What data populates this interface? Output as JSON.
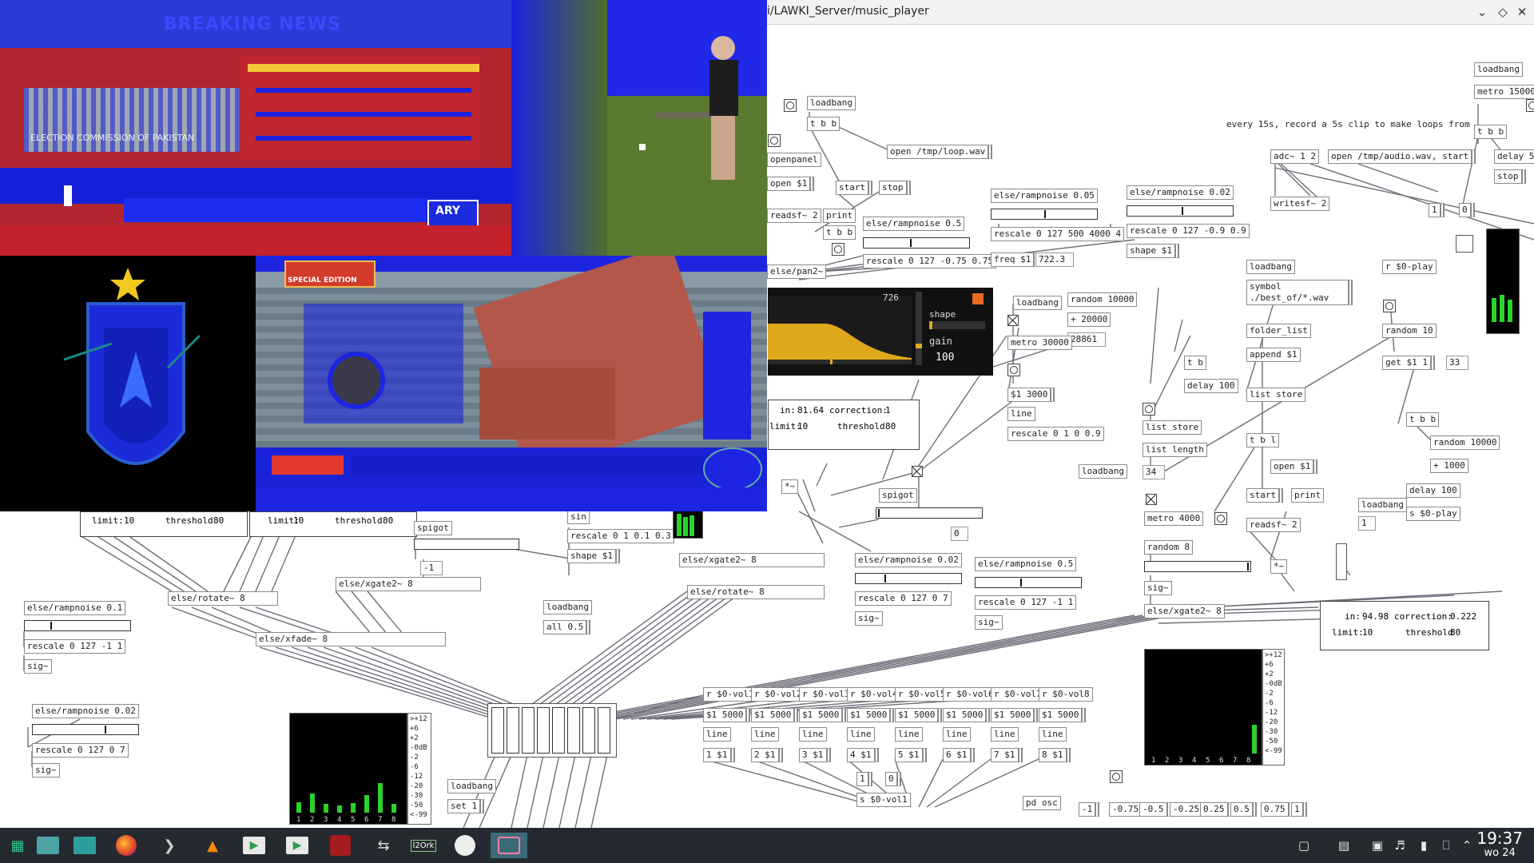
{
  "window": {
    "title": "i/LAWKI_Server/music_player",
    "controls": [
      "minimize",
      "maximize",
      "close"
    ]
  },
  "objects": {
    "loadbang1": "loadbang",
    "tbb1": "t b b",
    "openpanel": "openpanel",
    "open1": "open $1",
    "openloop": "open /tmp/loop.wav",
    "start1": "start",
    "stop1": "stop",
    "readsf1": "readsf~ 2",
    "print1": "print",
    "tbb2": "t b b",
    "rampnoise05": "else/rampnoise 0.5",
    "rescale075": "rescale 0 127 -0.75 0.75",
    "pan2": "else/pan2~",
    "rampnoise005": "else/rampnoise 0.05",
    "rescale500": "rescale 0 127 500 4000 4",
    "freq": "freq $1",
    "num7223": "722.3",
    "rampnoise002a": "else/rampnoise 0.02",
    "rescale09": "rescale 0 127 -0.9 0.9",
    "shape1": "shape $1",
    "loadbang2": "loadbang",
    "random10000a": "random 10000",
    "plus20000": "+ 20000",
    "num28861": "28861",
    "metro30000": "metro 30000",
    "msg3000": "$1 3000",
    "line1": "line",
    "rescale019": "rescale 0 1 0 0.9",
    "comment15s": "every 15s, record a 5s clip to make loops from",
    "loadbang3": "loadbang",
    "metro15000": "metro 15000",
    "tbb3": "t b b",
    "adc": "adc~ 1 2",
    "openaudio": "open /tmp/audio.wav, start",
    "delay5": "delay 5",
    "stop2": "stop",
    "writesf": "writesf~ 2",
    "num1": "1",
    "num0": "0",
    "loadbang4": "loadbang",
    "symbol": "symbol ./best_of/*.wav",
    "folderlist": "folder_list",
    "append": "append $1",
    "liststore1": "list store",
    "rplay": "r $0-play",
    "random10": "random 10",
    "get1": "get $1 1",
    "num33": "33",
    "tb": "t b",
    "delay100a": "delay 100",
    "liststore2": "list store",
    "listlength": "list length",
    "num34": "34",
    "tbl": "t b l",
    "open2": "open $1",
    "print2": "print",
    "start2": "start",
    "readsf2": "readsf~ 2",
    "tbb4": "t b b",
    "random10000b": "random 10000",
    "plus1000": "+ 1000",
    "delay100b": "delay 100",
    "splay": "s $0-play",
    "loadbang5": "loadbang",
    "num1b": "1",
    "mul1": "*~",
    "mul2": "*~",
    "loadbang6": "loadbang",
    "metro4000": "metro 4000",
    "random8": "random 8",
    "sig1": "sig~",
    "xgate1": "else/xgate2~ 8",
    "spigot1": "spigot",
    "num0b": "0",
    "rampnoise002b": "else/rampnoise 0.02",
    "rescale0707": "rescale 0 127 0 7",
    "sig2": "sig~",
    "rampnoise05b": "else/rampnoise 0.5",
    "rescale11": "rescale 0 127 -1 1",
    "sig3": "sig~",
    "xgate2": "else/xgate2~ 8",
    "rotate1": "else/rotate~ 8",
    "sin": "sin",
    "rescale013": "rescale 0 1 0.1 0.3",
    "shape2": "shape $1",
    "spigot2": "spigot",
    "numneg1": "-1",
    "rotate2": "else/rotate~ 8",
    "xgate3": "else/xgate2~ 8",
    "xfade": "else/xfade~ 8",
    "loadbang7": "loadbang",
    "all05": "all 0.5",
    "rampnoise01": "else/rampnoise 0.1",
    "rescale127": "rescale 0 127 -1 1",
    "sig4": "sig~",
    "rampnoise002c": "else/rampnoise 0.02",
    "rescale07b": "rescale 0 127 0 7",
    "sig5": "sig~",
    "loadbang8": "loadbang",
    "set1": "set 1",
    "pdosc": "pd osc",
    "svol1": "s $0-vol1",
    "n1": "1",
    "n0": "0"
  },
  "vols": [
    {
      "r": "r $0-vol1",
      "m": "$1 5000",
      "l": "line",
      "o": "1 $1"
    },
    {
      "r": "r $0-vol2",
      "m": "$1 5000",
      "l": "line",
      "o": "2 $1"
    },
    {
      "r": "r $0-vol3",
      "m": "$1 5000",
      "l": "line",
      "o": "3 $1"
    },
    {
      "r": "r $0-vol4",
      "m": "$1 5000",
      "l": "line",
      "o": "4 $1"
    },
    {
      "r": "r $0-vol5",
      "m": "$1 5000",
      "l": "line",
      "o": "5 $1"
    },
    {
      "r": "r $0-vol6",
      "m": "$1 5000",
      "l": "line",
      "o": "6 $1"
    },
    {
      "r": "r $0-vol7",
      "m": "$1 5000",
      "l": "line",
      "o": "7 $1"
    },
    {
      "r": "r $0-vol8",
      "m": "$1 5000",
      "l": "line",
      "o": "8 $1"
    }
  ],
  "oscmsgs": [
    "-1",
    "-0.75",
    "-0.5",
    "-0.25",
    "0.25",
    "0.5",
    "0.75",
    "1"
  ],
  "panels": {
    "p1": {
      "in_label": "in:",
      "in": "81.64",
      "corr_label": "correction:",
      "corr": "1",
      "limit_label": "limit:",
      "limit": "10",
      "thr_label": "threshold",
      "thr": "80"
    },
    "p2": {
      "in_label": "in:",
      "in": "94.98",
      "corr_label": "correction:",
      "corr": "0.222",
      "limit_label": "limit:",
      "limit": "10",
      "thr_label": "threshold",
      "thr": "80"
    },
    "p3": {
      "limit_label": "limit:",
      "limit": "10",
      "thr_label": "threshold",
      "thr": "80"
    },
    "p4": {
      "limit_label": "limit:",
      "limit": "10",
      "thr_label": "threshold",
      "thr": "80"
    }
  },
  "synth": {
    "freq": "726",
    "shape_label": "shape",
    "gain_label": "gain",
    "gain": "100"
  },
  "vu": {
    "ticks": [
      ">+12",
      "+6",
      "+2",
      "-0dB",
      "-2",
      "-6",
      "-12",
      "-20",
      "-30",
      "-50",
      "<-99"
    ],
    "channels": [
      "1",
      "2",
      "3",
      "4",
      "5",
      "6",
      "7",
      "8"
    ],
    "levels_a": [
      0.12,
      0.22,
      0.1,
      0.08,
      0.11,
      0.2,
      0.34,
      0.1
    ],
    "level_b": 0.33
  },
  "videos": {
    "news1": {
      "banner": "BREAKING NEWS",
      "logo": "ARY",
      "org": "ELECTION COMMISSION OF PAKISTAN"
    },
    "news2": {
      "banner": "SPECIAL EDITION"
    }
  },
  "taskbar": {
    "apps": [
      "menu-icon",
      "file-manager-icon",
      "files-icon",
      "firefox-icon",
      "terminal-icon",
      "vlc-icon",
      "media-player-icon",
      "player-icon",
      "pd-icon",
      "vnc-icon",
      "120rk-icon",
      "obs-icon",
      "screenshot-icon"
    ],
    "time": "19:37",
    "date": "wo 24"
  },
  "colors": {
    "vu_green": "#2bd32b",
    "vu_yellow": "#e6c11d",
    "synth_orange": "#e0a91d",
    "video_blue": "#1b23e0",
    "video_red": "#c4232e"
  }
}
